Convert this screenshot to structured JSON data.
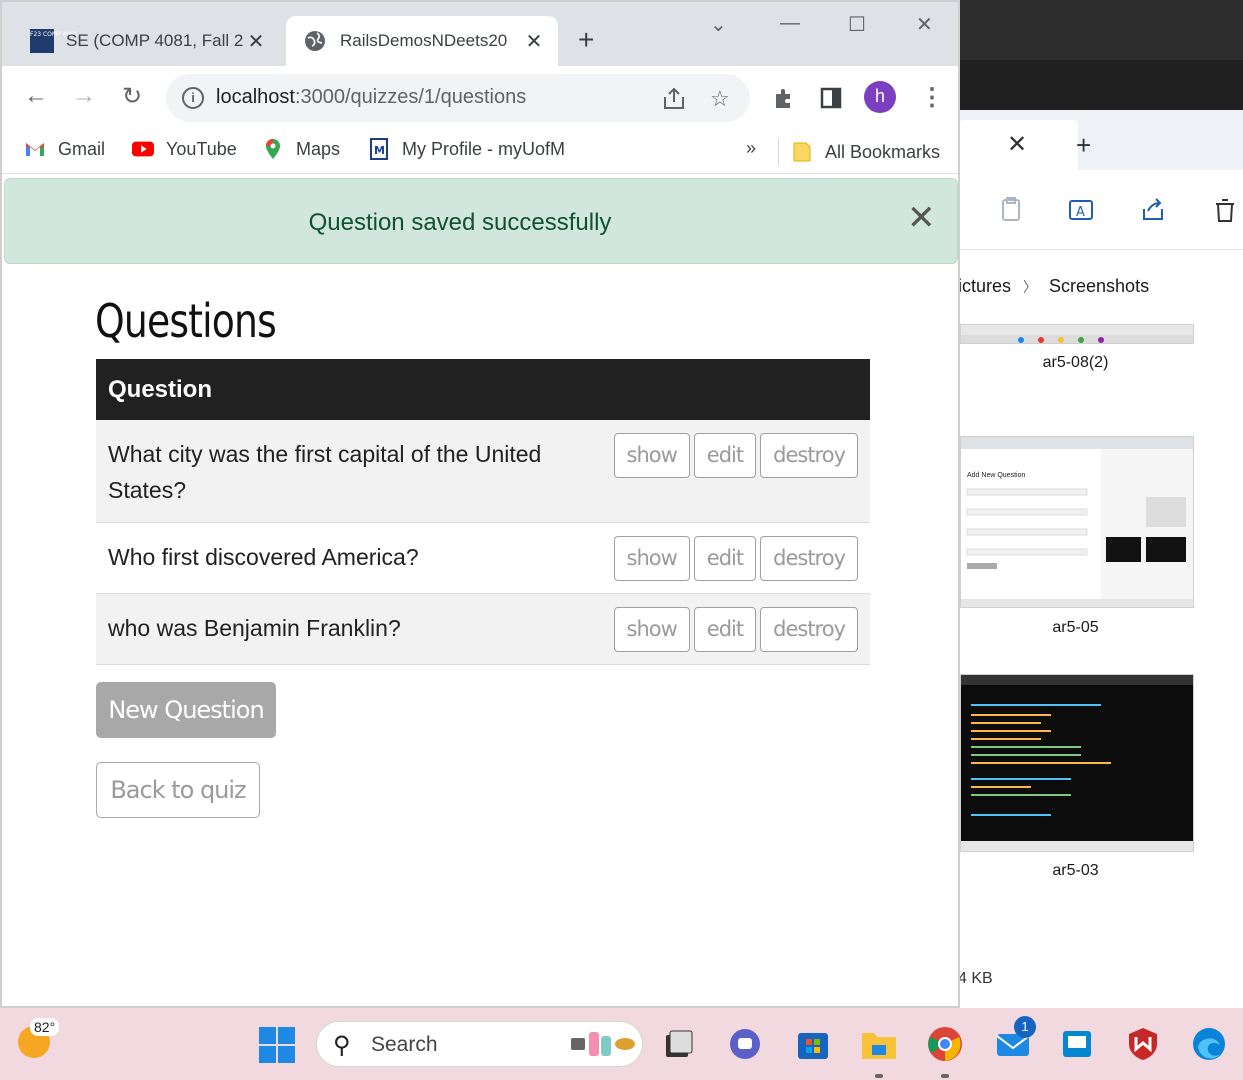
{
  "browser": {
    "tabs": [
      {
        "title": "SE (COMP 4081, Fall 2",
        "favicon_text": "F23 COMP 4081",
        "active": false
      },
      {
        "title": "RailsDemosNDeets20",
        "active": true
      }
    ],
    "url_host": "localhost",
    "url_path": ":3000/quizzes/1/questions",
    "avatar_letter": "h",
    "bookmarks": [
      "Gmail",
      "YouTube",
      "Maps",
      "My Profile - myUofM"
    ],
    "bookmarks_overflow": "»",
    "all_bookmarks": "All Bookmarks"
  },
  "page": {
    "flash": "Question saved successfully",
    "heading": "Questions",
    "table_header": "Question",
    "rows": [
      {
        "question": "What city was the first capital of the United States?",
        "actions": [
          "show",
          "edit",
          "destroy"
        ]
      },
      {
        "question": "Who first discovered America?",
        "actions": [
          "show",
          "edit",
          "destroy"
        ]
      },
      {
        "question": "who was Benjamin Franklin?",
        "actions": [
          "show",
          "edit",
          "destroy"
        ]
      }
    ],
    "new_button": "New Question",
    "back_button": "Back to quiz"
  },
  "explorer": {
    "breadcrumb": [
      "ictures",
      "Screenshots"
    ],
    "files": [
      "ar5-08(2)",
      "ar5-05",
      "ar5-03"
    ],
    "status": "4 KB"
  },
  "taskbar": {
    "temperature": "82°",
    "search_placeholder": "Search",
    "mail_badge": "1"
  },
  "colors": {
    "flash_bg": "#d1e7dd",
    "flash_text": "#0f5132",
    "table_header_bg": "#212121",
    "avatar": "#7b3fbf"
  }
}
